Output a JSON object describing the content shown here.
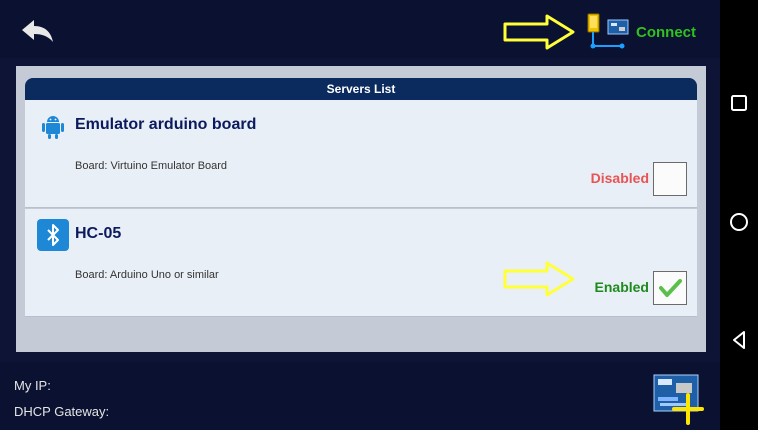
{
  "topbar": {
    "back_icon": "back-arrow-icon",
    "connect_label": "Connect",
    "connect_icon": "phone-to-board-icon",
    "hint_arrow_icon": "yellow-arrow-icon"
  },
  "servers": {
    "header": "Servers List",
    "items": [
      {
        "title": "Emulator arduino board",
        "board": "Board: Virtuino Emulator Board",
        "state": "Disabled",
        "checked": false,
        "icon": "android-icon"
      },
      {
        "title": "HC-05",
        "board": "Board: Arduino Uno or similar",
        "state": "Enabled",
        "checked": true,
        "icon": "bluetooth-icon"
      }
    ]
  },
  "footer": {
    "my_ip_label": "My IP:",
    "dhcp_gateway_label": "DHCP Gateway:",
    "add_icon": "add-board-icon"
  },
  "colors": {
    "connect_green": "#2fc21f",
    "disabled_red": "#e85353",
    "enabled_green": "#1e8a1e",
    "header_blue": "#0b2b5e",
    "hint_yellow": "#ffff3a"
  }
}
